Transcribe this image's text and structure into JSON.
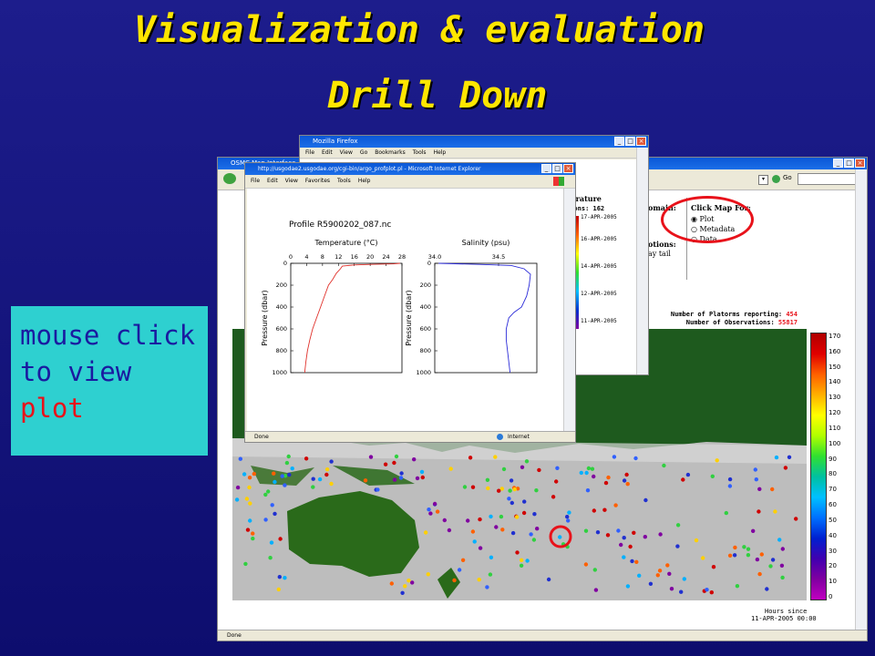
{
  "slide": {
    "title_line1": "Visualization & evaluation",
    "title_line2": "Drill Down",
    "callout_prefix": "mouse click to view ",
    "callout_highlight": "plot",
    "background_color": "#13137d",
    "title_color": "#ffe600",
    "callout_bg": "#2ed0d0"
  },
  "back_window": {
    "title": "OSMC Map Interface",
    "status": "Done",
    "go_label": "Go",
    "legend_title_1": "Number of Platorms reporting:",
    "platform_count": "454",
    "legend_title_2": "Number of Observations:",
    "observation_count": "55817",
    "color_scale_ticks": [
      "170",
      "160",
      "150",
      "140",
      "130",
      "120",
      "110",
      "100",
      "90",
      "80",
      "70",
      "60",
      "50",
      "40",
      "30",
      "20",
      "10",
      "0"
    ],
    "scale_caption_1": "Hours since",
    "scale_caption_2": "11-APR-2005 00:00",
    "domain_label": "omain:",
    "options_label": "otions:",
    "options_value": "ay tail",
    "click_map_title": "Click Map For:",
    "click_map_options": [
      "Plot",
      "Metadata",
      "Data"
    ]
  },
  "mid_window": {
    "title": "Mozilla Firefox",
    "menu": [
      "File",
      "Edit",
      "View",
      "Go",
      "Bookmarks",
      "Tools",
      "Help"
    ],
    "heading": "perature",
    "stations_label": "tions: 162",
    "date_ticks": [
      "17-APR-2005",
      "16-APR-2005",
      "14-APR-2005",
      "12-APR-2005",
      "11-APR-2005"
    ]
  },
  "front_window": {
    "title": "http://usgodae2.usgodae.org/cgi-bin/argo_profplot.pl - Microsoft Internet Explorer",
    "menu": [
      "File",
      "Edit",
      "View",
      "Favorites",
      "Tools",
      "Help"
    ],
    "status_left": "Done",
    "status_right": "Internet",
    "plot_title": "Profile R5900202_087.nc"
  },
  "chart_data": [
    {
      "type": "line",
      "title": "Temperature (°C)",
      "xlabel": "Temperature (°C)",
      "ylabel": "Pressure (dbar)",
      "xlim": [
        0,
        28
      ],
      "ylim": [
        1000,
        0
      ],
      "x_ticks": [
        "0",
        "4",
        "8",
        "12",
        "16",
        "20",
        "24",
        "28"
      ],
      "y_ticks": [
        "0",
        "200",
        "400",
        "600",
        "800",
        "1000"
      ],
      "series": [
        {
          "color": "#e0302a",
          "points": [
            [
              27.5,
              0
            ],
            [
              26,
              5
            ],
            [
              20,
              10
            ],
            [
              16,
              15
            ],
            [
              13,
              25
            ],
            [
              12.5,
              50
            ],
            [
              11.5,
              90
            ],
            [
              10.5,
              150
            ],
            [
              9.5,
              200
            ],
            [
              8.5,
              300
            ],
            [
              7.5,
              400
            ],
            [
              6.5,
              500
            ],
            [
              5.5,
              600
            ],
            [
              4.8,
              700
            ],
            [
              4.2,
              800
            ],
            [
              3.8,
              900
            ],
            [
              3.5,
              1000
            ]
          ]
        }
      ]
    },
    {
      "type": "line",
      "title": "Salinity (psu)",
      "xlabel": "Salinity (psu)",
      "ylabel": "Pressure (dbar)",
      "xlim": [
        34.0,
        34.8
      ],
      "ylim": [
        1000,
        0
      ],
      "x_ticks": [
        "34.0",
        "34.5"
      ],
      "y_ticks": [
        "0",
        "200",
        "400",
        "600",
        "800",
        "1000"
      ],
      "series": [
        {
          "color": "#2a2ad8",
          "points": [
            [
              34.03,
              0
            ],
            [
              34.35,
              10
            ],
            [
              34.6,
              20
            ],
            [
              34.7,
              50
            ],
            [
              34.75,
              100
            ],
            [
              34.74,
              200
            ],
            [
              34.72,
              300
            ],
            [
              34.68,
              400
            ],
            [
              34.62,
              450
            ],
            [
              34.58,
              500
            ],
            [
              34.56,
              600
            ],
            [
              34.56,
              700
            ],
            [
              34.57,
              800
            ],
            [
              34.58,
              900
            ],
            [
              34.59,
              1000
            ]
          ]
        }
      ]
    }
  ]
}
